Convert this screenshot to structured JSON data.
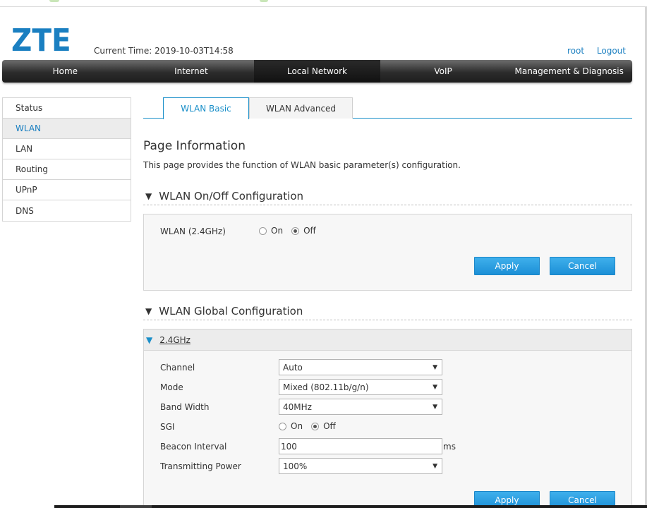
{
  "header": {
    "logo": "ZTE",
    "current_time": "Current Time: 2019-10-03T14:58",
    "user": "root",
    "logout": "Logout"
  },
  "nav": {
    "items": [
      "Home",
      "Internet",
      "Local Network",
      "VoIP",
      "Management & Diagnosis"
    ],
    "active": "Local Network"
  },
  "sidebar": {
    "items": [
      "Status",
      "WLAN",
      "LAN",
      "Routing",
      "UPnP",
      "DNS"
    ],
    "active": "WLAN"
  },
  "tabs": {
    "items": [
      "WLAN Basic",
      "WLAN Advanced"
    ],
    "active": "WLAN Basic"
  },
  "page": {
    "title": "Page Information",
    "description": "This page provides the function of WLAN basic parameter(s) configuration."
  },
  "onoff": {
    "title": "WLAN On/Off Configuration",
    "label": "WLAN (2.4GHz)",
    "on_label": "On",
    "off_label": "Off",
    "selected": "Off",
    "apply": "Apply",
    "cancel": "Cancel"
  },
  "global": {
    "title": "WLAN Global Configuration",
    "band": "2.4GHz",
    "channel_label": "Channel",
    "channel_value": "Auto",
    "mode_label": "Mode",
    "mode_value": "Mixed (802.11b/g/n)",
    "bandwidth_label": "Band Width",
    "bandwidth_value": "40MHz",
    "sgi_label": "SGI",
    "sgi_on": "On",
    "sgi_off": "Off",
    "sgi_selected": "Off",
    "beacon_label": "Beacon Interval",
    "beacon_value": "100",
    "beacon_unit": "ms",
    "power_label": "Transmitting Power",
    "power_value": "100%",
    "apply": "Apply",
    "cancel": "Cancel"
  },
  "colors": {
    "brand": "#1a7fc1",
    "button": "#2a9ee0"
  }
}
